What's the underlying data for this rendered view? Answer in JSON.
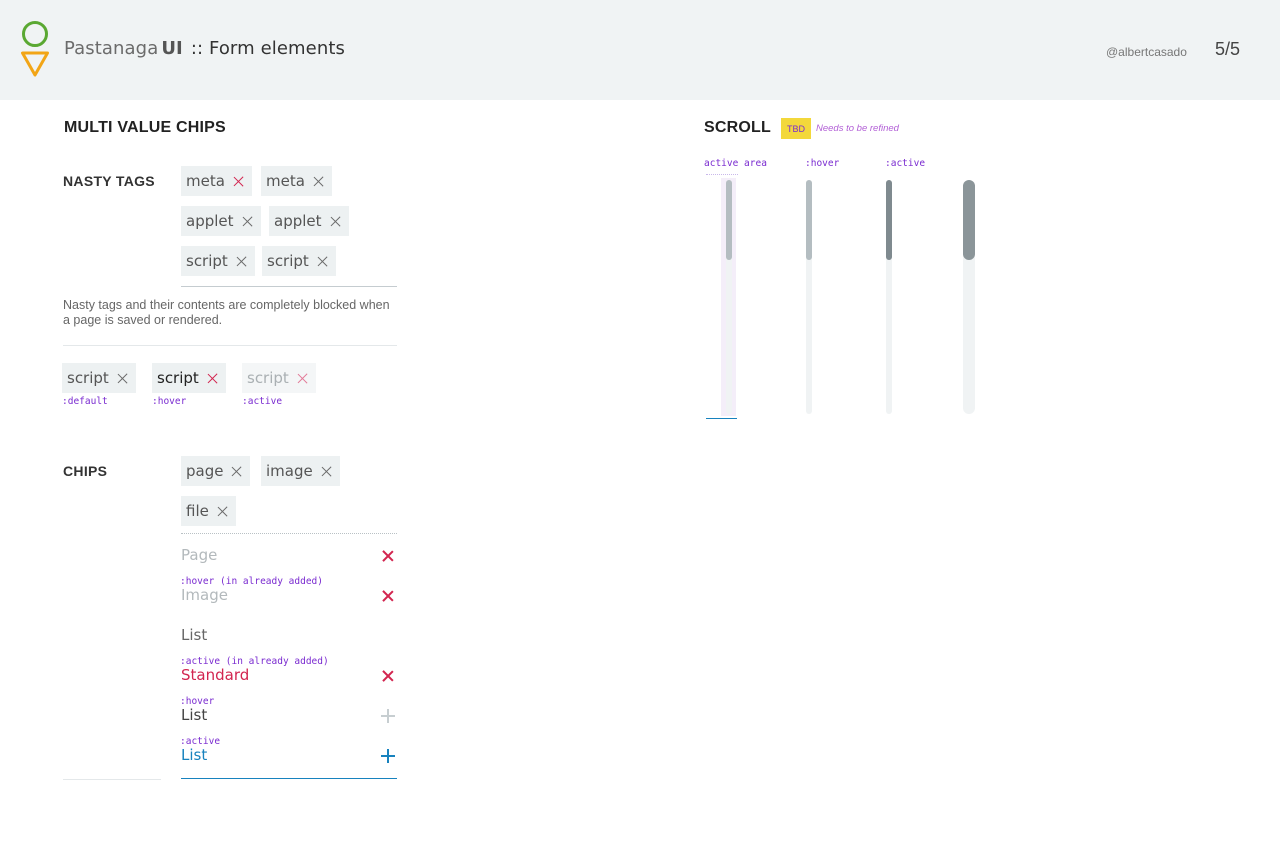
{
  "header": {
    "brand": "Pastanaga",
    "ui": "UI",
    "page_title": ":: Form elements",
    "author": "@albertcasado",
    "pager": "5/5"
  },
  "multi_value_chips": {
    "title": "MULTI VALUE CHIPS",
    "nasty_tags_label": "NASTY TAGS",
    "nasty_tags": [
      "meta",
      "meta",
      "applet",
      "applet",
      "script",
      "script"
    ],
    "hint": "Nasty tags and their contents are completely blocked when a page is saved or rendered.",
    "states": [
      {
        "chip": "script",
        "label": ":default"
      },
      {
        "chip": "script",
        "label": ":hover"
      },
      {
        "chip": "script",
        "label": ":active"
      }
    ]
  },
  "chips": {
    "label": "CHIPS",
    "items": [
      "page",
      "image",
      "file"
    ],
    "options": {
      "page": "Page",
      "hover_added_label": ":hover (in already added)",
      "image": "Image",
      "list_plain": "List",
      "active_added_label": ":active (in already added)",
      "standard": "Standard",
      "hover_label": ":hover",
      "list_hover": "List",
      "active_label": ":active",
      "list_active": "List"
    }
  },
  "scroll": {
    "title": "SCROLL",
    "badge": "TBD",
    "note": "Needs to be refined",
    "labels": {
      "active_area": "active area",
      "hover": ":hover",
      "active": ":active"
    }
  },
  "colors": {
    "accent_red": "#d2254f",
    "accent_blue": "#1782be",
    "annotation_purple": "#7a2bd0",
    "badge_yellow": "#f3d83b",
    "logo_green": "#5aa832",
    "logo_orange": "#f2a516"
  },
  "icons": [
    "logo-icon",
    "close-icon",
    "add-icon"
  ]
}
